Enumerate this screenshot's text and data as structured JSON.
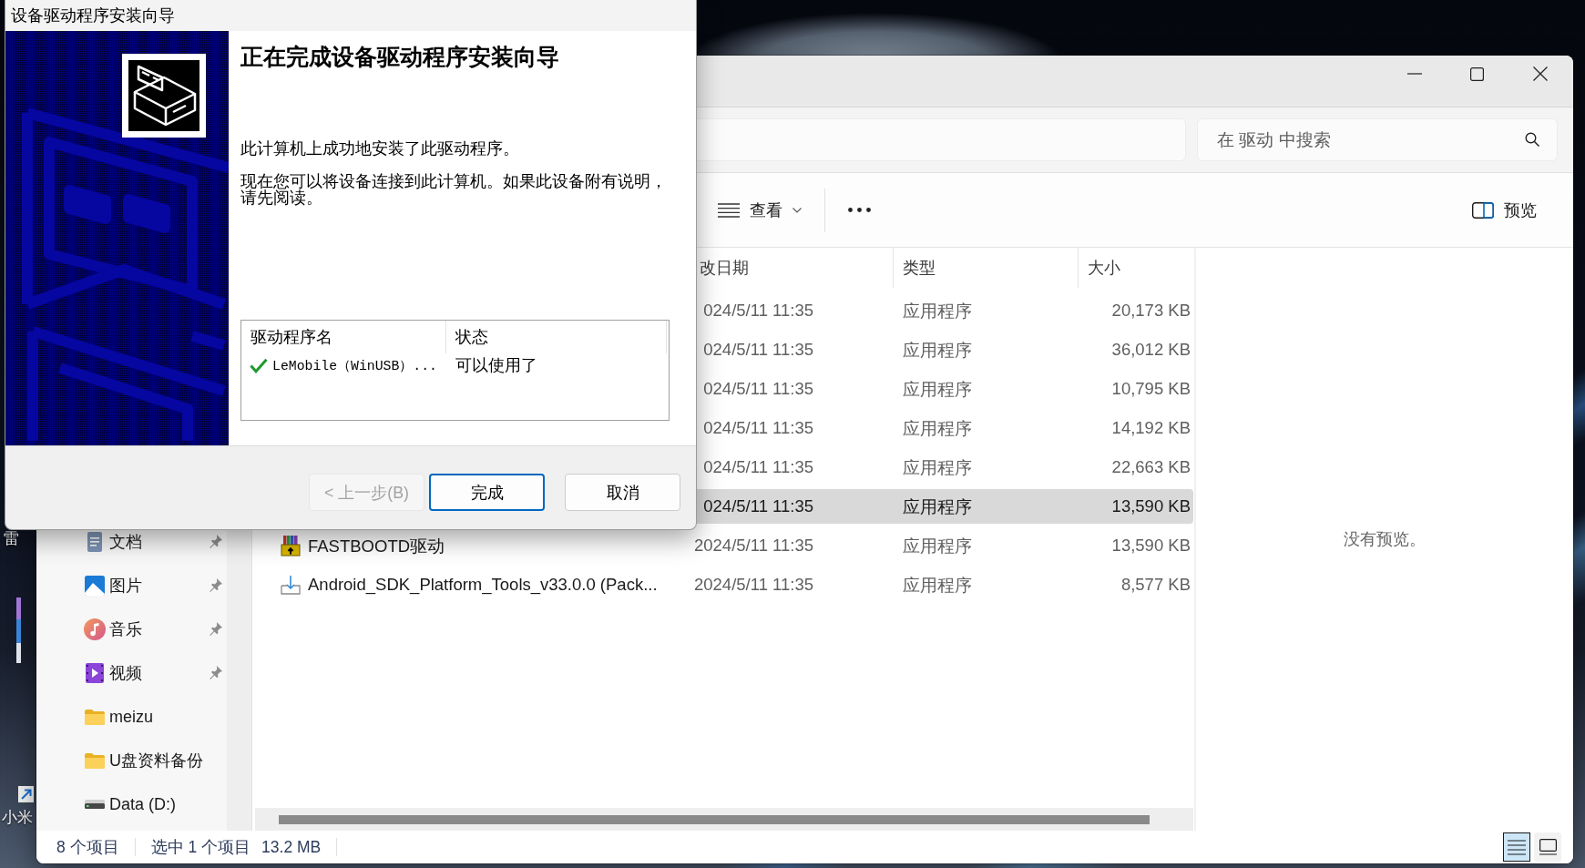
{
  "dialog": {
    "title": "设备驱动程序安装向导",
    "heading": "正在完成设备驱动程序安装向导",
    "paragraphs": [
      "此计算机上成功地安装了此驱动程序。",
      "现在您可以将设备连接到此计算机。如果此设备附有说明，请先阅读。"
    ],
    "driver_table": {
      "columns": [
        "驱动程序名",
        "状态"
      ],
      "rows": [
        {
          "name": "LeMobile（WinUSB）...",
          "status": "可以使用了",
          "success": true
        }
      ]
    },
    "buttons": [
      {
        "label": "< 上一步(B)",
        "disabled": true,
        "default": false
      },
      {
        "label": "完成",
        "disabled": false,
        "default": true
      },
      {
        "label": "取消",
        "disabled": false,
        "default": false
      }
    ]
  },
  "explorer": {
    "search": {
      "placeholder": "在 驱动 中搜索"
    },
    "toolbar": {
      "view": "查看",
      "preview": "预览"
    },
    "navigation": [
      {
        "kind": "documents",
        "label": "文档",
        "pinned": true
      },
      {
        "kind": "pictures",
        "label": "图片",
        "pinned": true
      },
      {
        "kind": "music",
        "label": "音乐",
        "pinned": true
      },
      {
        "kind": "videos",
        "label": "视频",
        "pinned": true
      },
      {
        "kind": "folder",
        "label": "meizu",
        "pinned": false
      },
      {
        "kind": "folder",
        "label": "U盘资料备份",
        "pinned": false
      },
      {
        "kind": "drive",
        "label": "Data (D:)",
        "pinned": false
      }
    ],
    "columns": [
      {
        "label": "改日期"
      },
      {
        "label": "类型"
      },
      {
        "label": "大小"
      }
    ],
    "files": [
      {
        "date": "024/5/11 11:35",
        "type": "应用程序",
        "size": "20,173 KB",
        "selected": false
      },
      {
        "date": "024/5/11 11:35",
        "type": "应用程序",
        "size": "36,012 KB",
        "selected": false
      },
      {
        "date": "024/5/11 11:35",
        "type": "应用程序",
        "size": "10,795 KB",
        "selected": false
      },
      {
        "date": "024/5/11 11:35",
        "type": "应用程序",
        "size": "14,192 KB",
        "selected": false
      },
      {
        "date": "024/5/11 11:35",
        "type": "应用程序",
        "size": "22,663 KB",
        "selected": false
      },
      {
        "date": "024/5/11 11:35",
        "type": "应用程序",
        "size": "13,590 KB",
        "selected": true
      },
      {
        "kind": "archive",
        "name": "FASTBOOTD驱动",
        "date": "2024/5/11 11:35",
        "type": "应用程序",
        "size": "13,590 KB",
        "selected": false
      },
      {
        "kind": "installer",
        "name": "Android_SDK_Platform_Tools_v33.0.0 (Pack...",
        "date": "2024/5/11 11:35",
        "type": "应用程序",
        "size": "8,577 KB",
        "selected": false
      }
    ],
    "preview_message": "没有预览。",
    "status_bar": {
      "items": "8 个项目",
      "selection": "选中 1 个项目",
      "selection_size": "13.2 MB"
    },
    "view_buttons": [
      {
        "kind": "details",
        "selected": true
      },
      {
        "kind": "tiles",
        "selected": false
      }
    ]
  },
  "desktop": {
    "icons": [
      {
        "label": "雷"
      },
      {
        "label": "小米",
        "shortcut": true
      }
    ]
  }
}
